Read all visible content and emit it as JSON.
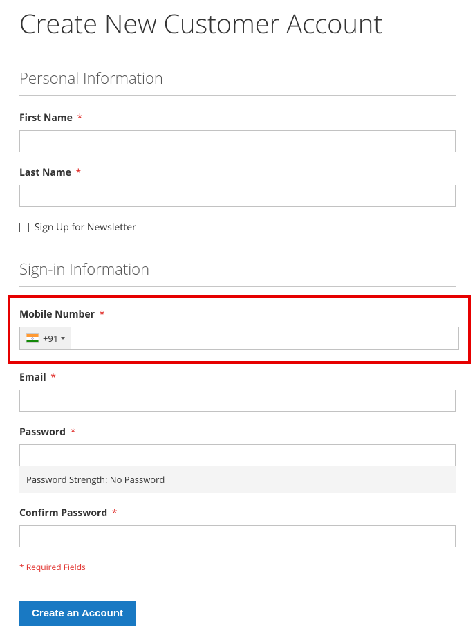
{
  "pageTitle": "Create New Customer Account",
  "personal": {
    "legend": "Personal Information",
    "firstNameLabel": "First Name",
    "firstNameValue": "",
    "lastNameLabel": "Last Name",
    "lastNameValue": "",
    "newsletterLabel": "Sign Up for Newsletter"
  },
  "signIn": {
    "legend": "Sign-in Information",
    "mobileLabel": "Mobile Number",
    "dialCode": "+91",
    "mobileValue": "",
    "emailLabel": "Email",
    "emailValue": "",
    "passwordLabel": "Password",
    "passwordValue": "",
    "passwordStrengthLabel": "Password Strength: ",
    "passwordStrengthValue": "No Password",
    "confirmPasswordLabel": "Confirm Password",
    "confirmPasswordValue": ""
  },
  "requiredNote": "* Required Fields",
  "submitLabel": "Create an Account",
  "requiredMark": "*"
}
